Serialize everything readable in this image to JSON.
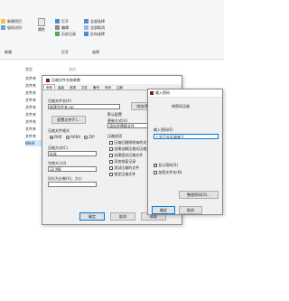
{
  "ribbon": {
    "new_item": "新建项目",
    "easy_access": "轻松访问",
    "properties": "属性",
    "open": "打开",
    "edit": "编辑",
    "history": "历史记录",
    "select_all": "全部选择",
    "select_none": "全部取消",
    "invert_selection": "反向选择",
    "group_new": "新建",
    "group_open": "打开",
    "group_select": "选择"
  },
  "filelist": {
    "col_type": "类型",
    "col_size": "大小",
    "rows": [
      "文件夹",
      "文件夹",
      "文件夹",
      "文件夹",
      "文件夹",
      "文件夹",
      "文件夹",
      "文件夹",
      "文件夹",
      "WinR"
    ]
  },
  "archive_dialog": {
    "title": "压缩文件名和参数",
    "tabs": [
      "常规",
      "高级",
      "选项",
      "文件",
      "备份",
      "时间",
      "注释"
    ],
    "filename_label": "压缩文件名(A)",
    "filename_value": "新建文件夹.rar",
    "browse_button": "浏览(B)...",
    "profiles_label": "默认配置",
    "profiles_button": "配置文件(F)...",
    "format_label": "压缩文件格式",
    "formats": [
      "RAR",
      "RAR4",
      "ZIP"
    ],
    "method_label": "压缩方式(C)",
    "method_value": "标准",
    "dict_label": "字典大小(I)",
    "dict_value": "32 MB",
    "split_label": "切分为分卷(V)，大小",
    "update_label": "更新方式(U)",
    "update_value": "添加并替换文件",
    "options_label": "压缩选项",
    "options": [
      "压缩后删除原来的文件",
      "创建自解压格式压缩文件",
      "创建固实压缩文件",
      "添加恢复记录",
      "测试压缩的文件",
      "锁定压缩文件"
    ],
    "password_button": "设置密码(P)...",
    "ok_button": "确定",
    "cancel_button": "取消",
    "help_button": "帮助"
  },
  "password_dialog": {
    "title": "输入密码",
    "subtitle": "带密码压缩",
    "prompt": "输入密码(E)",
    "password_value": "上学王社区调查王",
    "show_password": "显示密码(S)",
    "encrypt_names": "加密文件名(N)",
    "organize_button": "整理密码(O)...",
    "ok_button": "确定",
    "cancel_button": "取消"
  }
}
